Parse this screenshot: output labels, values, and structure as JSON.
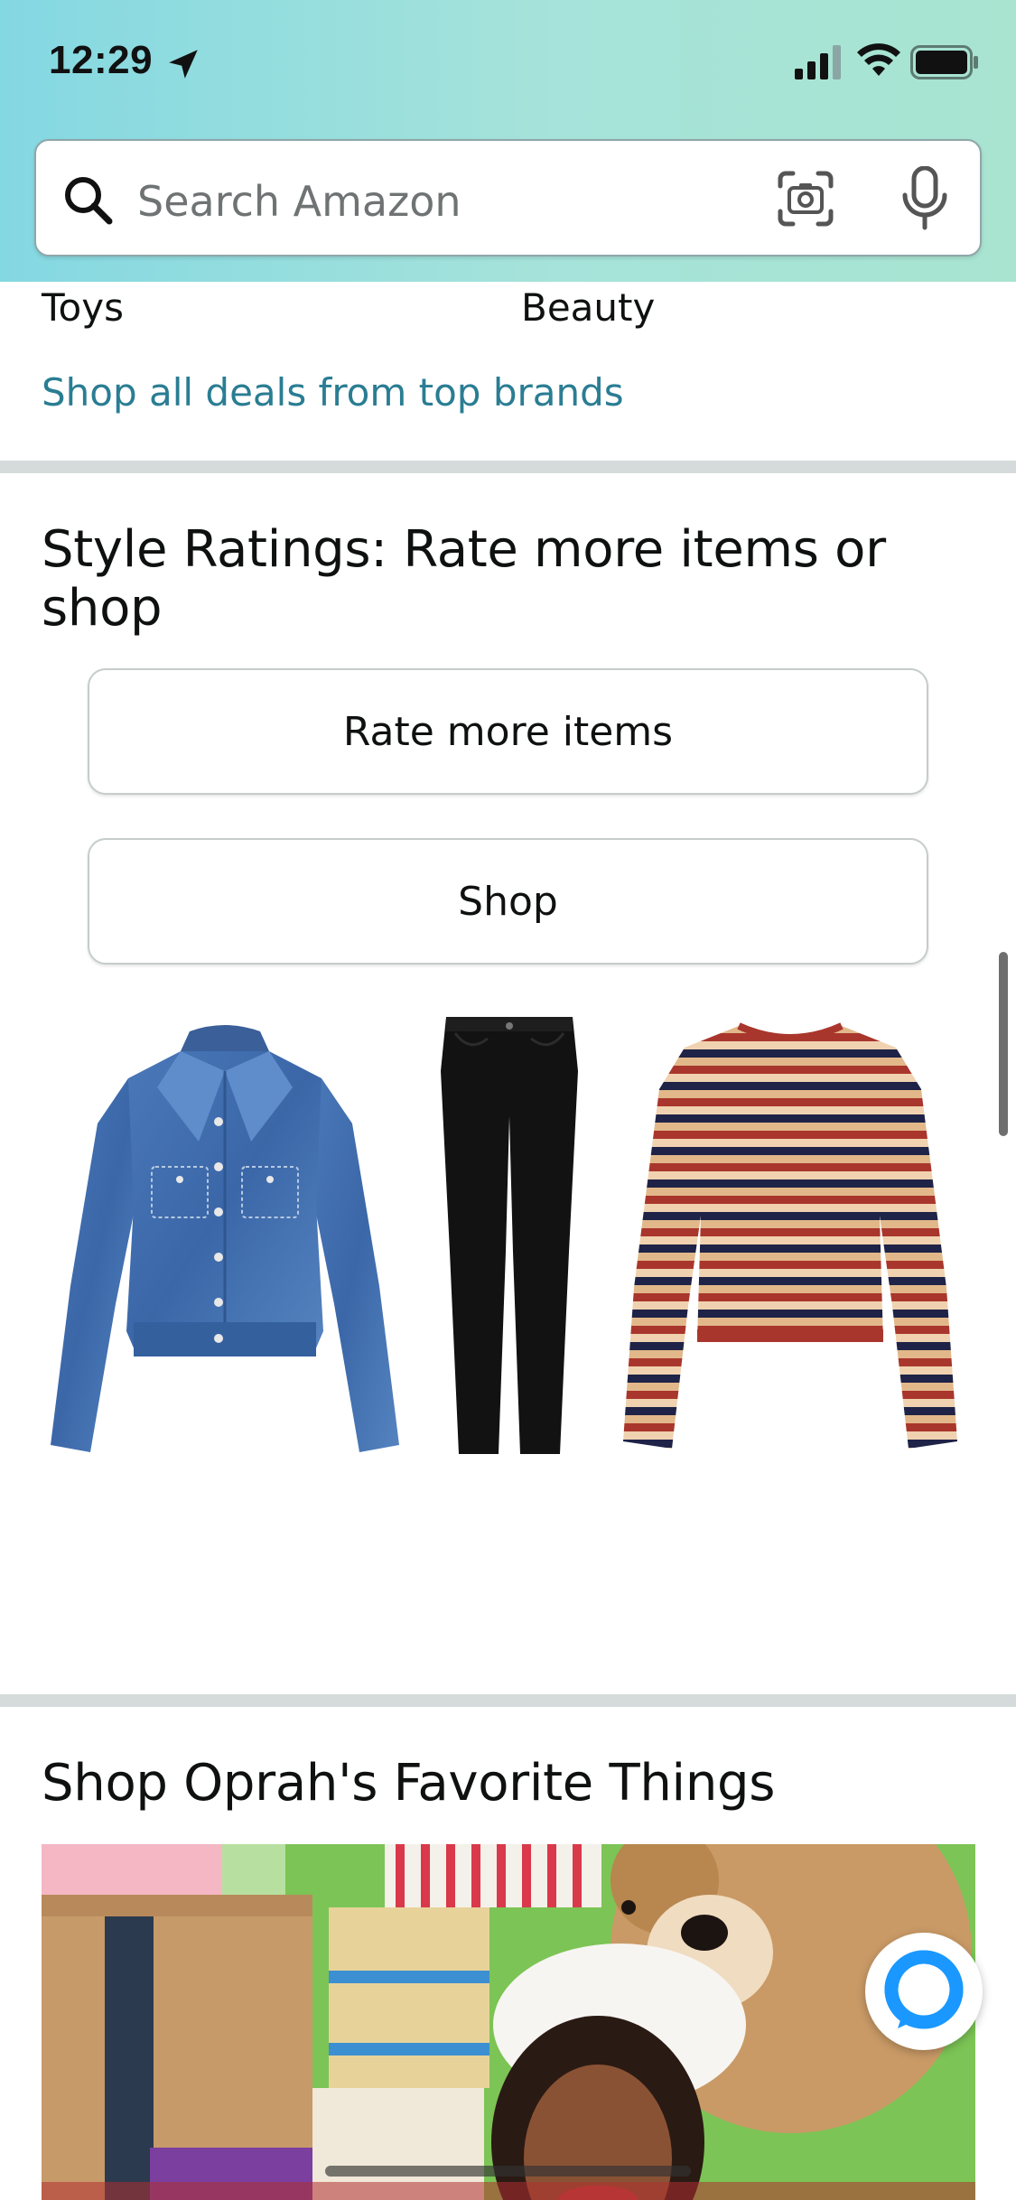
{
  "status_bar": {
    "time": "12:29",
    "icons": [
      "location-arrow-icon",
      "cellular-signal-icon",
      "wifi-icon",
      "battery-icon"
    ]
  },
  "search": {
    "placeholder": "Search Amazon",
    "icons": [
      "search-icon",
      "camera-scan-icon",
      "microphone-icon"
    ]
  },
  "deals": {
    "categories": [
      "Toys",
      "Beauty"
    ],
    "link": "Shop all deals from top brands"
  },
  "style_ratings": {
    "title": "Style Ratings: Rate more items or shop",
    "buttons": [
      "Rate more items",
      "Shop"
    ],
    "products": [
      "denim-jacket",
      "black-skinny-jeans",
      "striped-long-sleeve-top"
    ]
  },
  "oprah": {
    "title": "Shop Oprah's Favorite Things"
  },
  "colors": {
    "link": "#2a7d93",
    "divider": "#d5dbdb",
    "header_gradient_start": "#84d8e2",
    "header_gradient_end": "#a8e4d0",
    "alexa_accent": "#1a98ff"
  }
}
